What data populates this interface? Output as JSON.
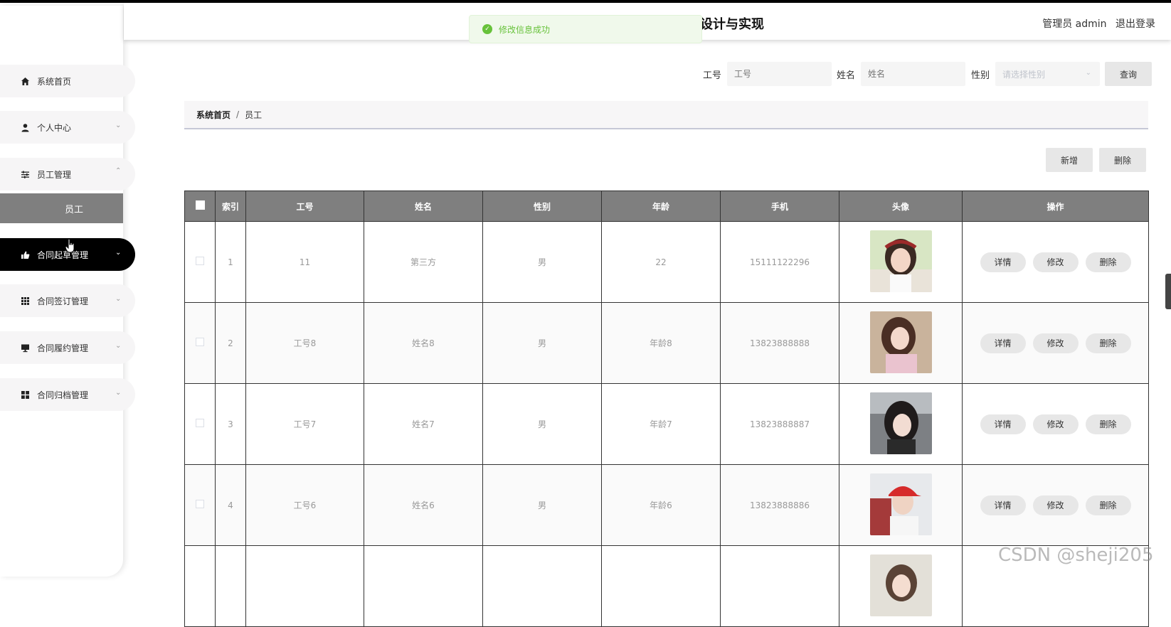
{
  "header": {
    "title": "设计与实现",
    "user_label": "管理员 admin",
    "logout": "退出登录"
  },
  "toast": {
    "message": "修改信息成功",
    "color": "#67c23a"
  },
  "sidebar": {
    "items": [
      {
        "label": "系统首页",
        "icon": "home-icon"
      },
      {
        "label": "个人中心",
        "icon": "user-icon"
      },
      {
        "label": "员工管理",
        "icon": "sliders-icon"
      },
      {
        "label": "合同起草管理",
        "icon": "thumbs-up-icon"
      },
      {
        "label": "合同签订管理",
        "icon": "grid-icon"
      },
      {
        "label": "合同履约管理",
        "icon": "monitor-icon"
      },
      {
        "label": "合同归档管理",
        "icon": "apps-icon"
      }
    ],
    "sub_item": "员工"
  },
  "search": {
    "id_label": "工号",
    "id_placeholder": "工号",
    "name_label": "姓名",
    "name_placeholder": "姓名",
    "gender_label": "性别",
    "gender_placeholder": "请选择性别",
    "query_button": "查询"
  },
  "breadcrumb": {
    "home": "系统首页",
    "separator": "/",
    "current": "员工"
  },
  "actions": {
    "add": "新增",
    "delete": "删除"
  },
  "table": {
    "headers": [
      "索引",
      "工号",
      "姓名",
      "性别",
      "年龄",
      "手机",
      "头像",
      "操作"
    ],
    "op_labels": {
      "detail": "详情",
      "edit": "修改",
      "delete": "删除"
    },
    "rows": [
      {
        "index": "1",
        "id": "11",
        "name": "第三方",
        "gender": "男",
        "age": "22",
        "phone": "15111122296"
      },
      {
        "index": "2",
        "id": "工号8",
        "name": "姓名8",
        "gender": "男",
        "age": "年龄8",
        "phone": "13823888888"
      },
      {
        "index": "3",
        "id": "工号7",
        "name": "姓名7",
        "gender": "男",
        "age": "年龄7",
        "phone": "13823888887"
      },
      {
        "index": "4",
        "id": "工号6",
        "name": "姓名6",
        "gender": "男",
        "age": "年龄6",
        "phone": "13823888886"
      },
      {
        "index": "",
        "id": "",
        "name": "",
        "gender": "",
        "age": "",
        "phone": ""
      }
    ]
  },
  "watermark": "CSDN @sheji205"
}
